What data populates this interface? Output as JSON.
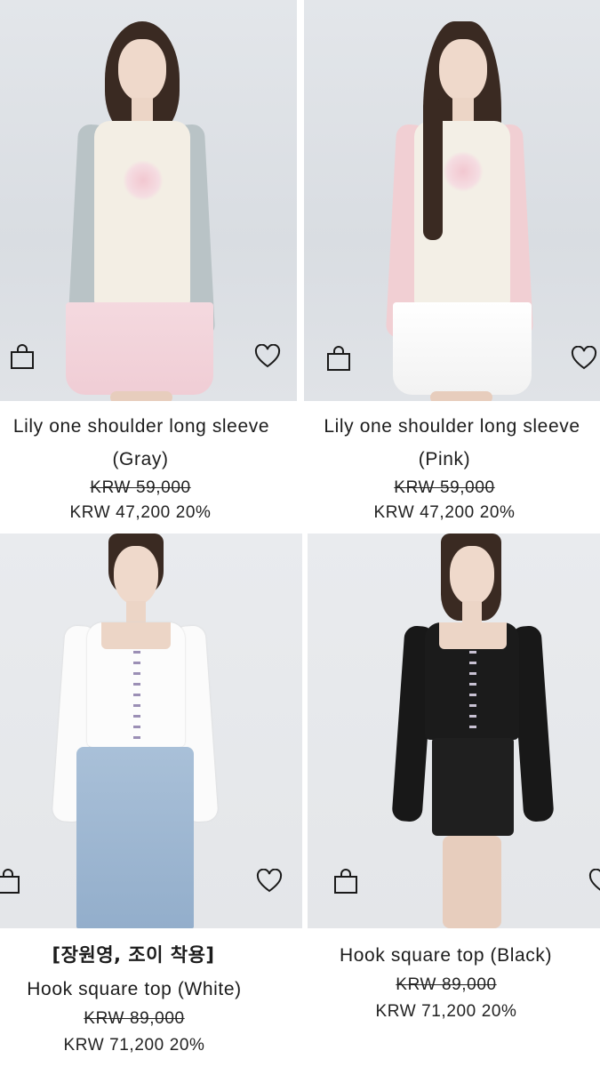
{
  "products": [
    {
      "tag": "",
      "name_line1": "Lily one shoulder long sleeve",
      "name_line2": "(Gray)",
      "original_price": "KRW 59,000",
      "sale_price": "KRW 47,200",
      "discount": "20%"
    },
    {
      "tag": "",
      "name_line1": "Lily one shoulder long sleeve",
      "name_line2": "(Pink)",
      "original_price": "KRW 59,000",
      "sale_price": "KRW 47,200",
      "discount": "20%"
    },
    {
      "tag": "[장원영, 조이 착용]",
      "name_line1": "Hook square top (White)",
      "name_line2": "",
      "original_price": "KRW 89,000",
      "sale_price": "KRW 71,200",
      "discount": "20%"
    },
    {
      "tag": "",
      "name_line1": "Hook square top (Black)",
      "name_line2": "",
      "original_price": "KRW 89,000",
      "sale_price": "KRW 71,200",
      "discount": "20%"
    }
  ],
  "icons": {
    "cart": "shopping-bag-icon",
    "wishlist": "heart-icon"
  }
}
